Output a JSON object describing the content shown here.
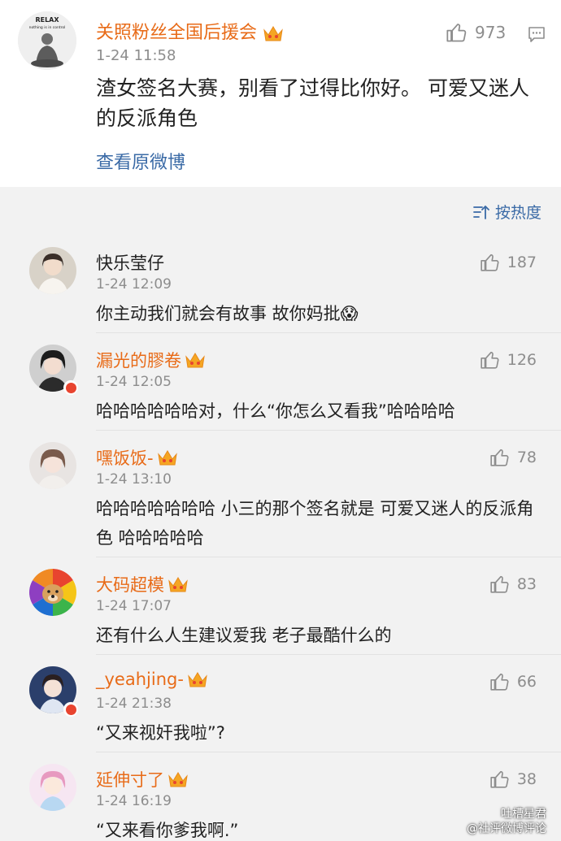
{
  "main_post": {
    "username": "关照粉丝全国后援会",
    "time": "1-24 11:58",
    "content": "渣女签名大赛，别看了过得比你好。 可爱又迷人的反派角色",
    "link": "查看原微博",
    "likes": "973",
    "avatar_text_1": "RELAX",
    "avatar_text_2": "nothing is in control"
  },
  "sort": {
    "label": "按热度"
  },
  "comments": [
    {
      "name": "快乐莹仔",
      "vip": false,
      "time": "1-24 12:09",
      "text": "你主动我们就会有故事 故你妈批😱",
      "likes": "187",
      "badge": false
    },
    {
      "name": "漏光的膠卷",
      "vip": true,
      "time": "1-24 12:05",
      "text": "哈哈哈哈哈哈对，什么“你怎么又看我”哈哈哈哈",
      "likes": "126",
      "badge": true
    },
    {
      "name": "嘿饭饭-",
      "vip": true,
      "time": "1-24 13:10",
      "text": "哈哈哈哈哈哈哈 小三的那个签名就是 可爱又迷人的反派角色 哈哈哈哈哈",
      "likes": "78",
      "badge": false
    },
    {
      "name": "大码超模",
      "vip": true,
      "time": "1-24 17:07",
      "text": "还有什么人生建议爱我 老子最酷什么的",
      "likes": "83",
      "badge": false
    },
    {
      "name": "_yeahjing-",
      "vip": true,
      "time": "1-24 21:38",
      "text": "“又来视奸我啦”?",
      "likes": "66",
      "badge": true
    },
    {
      "name": "延伸寸了",
      "vip": true,
      "time": "1-24 16:19",
      "text": "“又来看你爹我啊.”",
      "likes": "38",
      "badge": false
    }
  ],
  "watermark": {
    "line1": "吐槽星君",
    "line2": "@社评微博评论"
  },
  "colors": {
    "username": "#e86b18",
    "link": "#3a6aa6",
    "muted": "#8d8d8d"
  }
}
